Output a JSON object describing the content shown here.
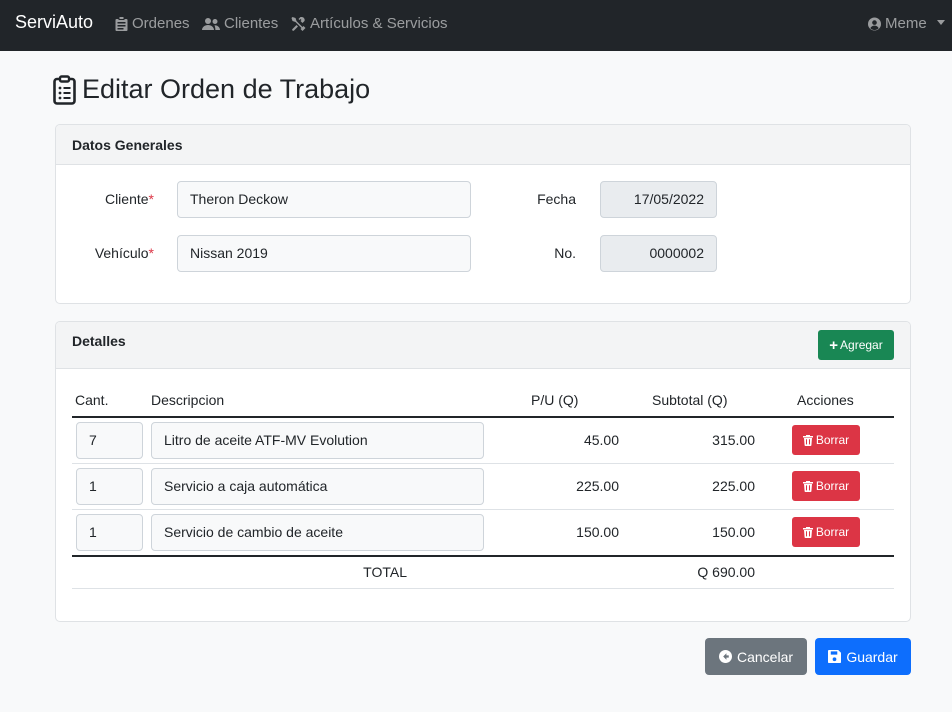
{
  "navbar": {
    "brand": "ServiAuto",
    "items": [
      {
        "label": "Ordenes",
        "icon": "clipboard-icon"
      },
      {
        "label": "Clientes",
        "icon": "users-icon"
      },
      {
        "label": "Artículos & Servicios",
        "icon": "tools-icon"
      }
    ],
    "user": {
      "label": "Meme",
      "icon": "user-circle-icon"
    }
  },
  "page": {
    "title": "Editar Orden de Trabajo",
    "title_icon": "clipboard-list-icon"
  },
  "general": {
    "header": "Datos Generales",
    "cliente_label": "Cliente",
    "cliente_value": "Theron Deckow",
    "vehiculo_label": "Vehículo",
    "vehiculo_value": "Nissan 2019",
    "required_mark": "*",
    "fecha_label": "Fecha",
    "fecha_value": "17/05/2022",
    "no_label": "No.",
    "no_value": "0000002"
  },
  "details": {
    "header": "Detalles",
    "add_label": "Agregar",
    "columns": [
      "Cant.",
      "Descripcion",
      "P/U (Q)",
      "Subtotal (Q)",
      "Acciones"
    ],
    "rows": [
      {
        "qty": "7",
        "description": "Litro de aceite ATF-MV Evolution",
        "unit_price": "45.00",
        "subtotal": "315.00",
        "action": "Borrar"
      },
      {
        "qty": "1",
        "description": "Servicio a caja automática",
        "unit_price": "225.00",
        "subtotal": "225.00",
        "action": "Borrar"
      },
      {
        "qty": "1",
        "description": "Servicio de cambio de aceite",
        "unit_price": "150.00",
        "subtotal": "150.00",
        "action": "Borrar"
      }
    ],
    "total_label": "TOTAL",
    "total_value": "Q 690.00"
  },
  "actions": {
    "cancel_label": "Cancelar",
    "save_label": "Guardar"
  },
  "colors": {
    "navbar": "#212529",
    "success": "#198754",
    "danger": "#dc3545",
    "secondary": "#6c757d",
    "primary": "#0d6efd"
  }
}
